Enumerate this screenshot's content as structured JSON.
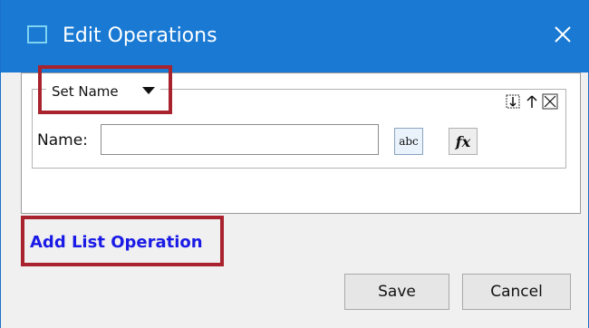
{
  "window": {
    "title": "Edit Operations",
    "close_icon": "close-icon",
    "app_icon": "window-icon"
  },
  "operation": {
    "type_label": "Set Name",
    "type_dropdown_icon": "chevron-down-icon",
    "name_label": "Name:",
    "name_value": "",
    "name_placeholder": "",
    "text_mode_label": "abc",
    "formula_mode_label": "fx",
    "row_icons": [
      "insert-icon",
      "move-up-icon",
      "remove-icon"
    ]
  },
  "add_list_operation_label": "Add List Operation",
  "buttons": {
    "save_label": "Save",
    "cancel_label": "Cancel"
  },
  "colors": {
    "titlebar": "#1979d3",
    "highlight": "#a8232d",
    "link": "#1a1ae6"
  }
}
